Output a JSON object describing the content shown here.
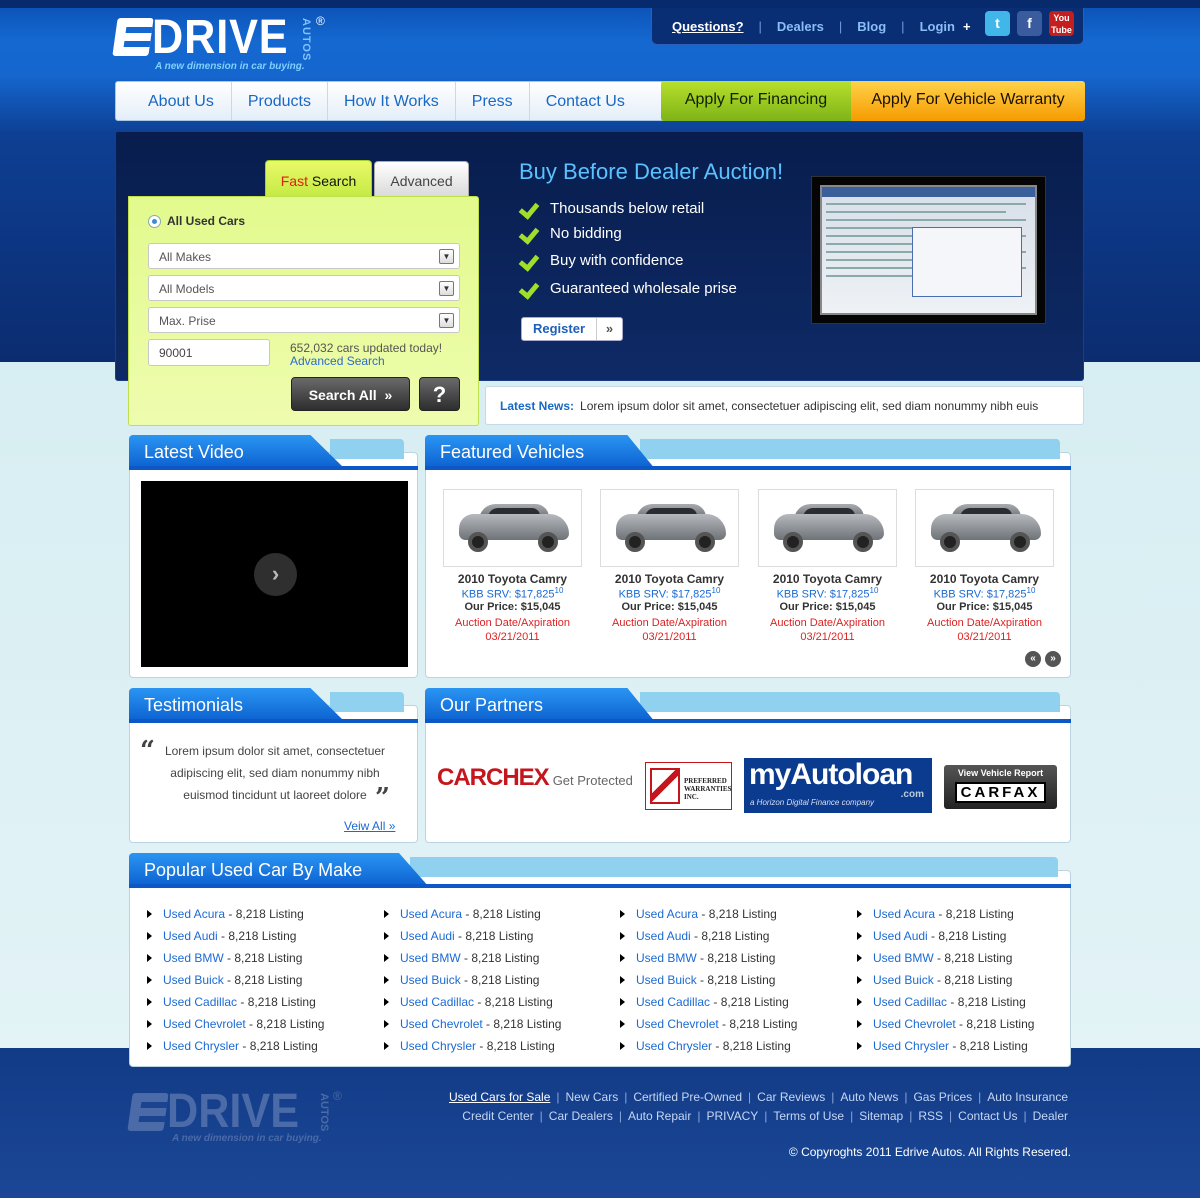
{
  "brand": {
    "name": "DRIVE",
    "sub": "AUTOS",
    "reg": "®",
    "tagline": "A new dimension in car buying."
  },
  "toplinks": [
    "Questions?",
    "Dealers",
    "Blog",
    "Login"
  ],
  "social": [
    "twitter-icon",
    "facebook-icon",
    "youtube-icon"
  ],
  "nav": [
    "About Us",
    "Products",
    "How It Works",
    "Press",
    "Contact Us"
  ],
  "nav_cta": {
    "financing": "Apply For Financing",
    "warranty": "Apply For Vehicle Warranty"
  },
  "search": {
    "tab_fast_a": "Fast",
    "tab_fast_b": " Search",
    "tab_advanced": "Advanced",
    "radio": "All Used Cars",
    "makes": "All Makes",
    "models": "All Models",
    "price": "Max. Prise",
    "zip": "90001",
    "count": "652,032 cars updated today!",
    "adv_link": "Advanced Search",
    "btn": "Search All",
    "btn_arrow": "»",
    "help": "?"
  },
  "hero": {
    "title": "Buy Before Dealer Auction!",
    "features": [
      "Thousands below retail",
      "No bidding",
      "Buy with confidence",
      "Guaranteed wholesale prise"
    ],
    "register": "Register",
    "register_arrow": "»"
  },
  "news": {
    "label": "Latest News:",
    "text": "Lorem ipsum dolor sit amet, consectetuer adipiscing elit, sed diam nonummy nibh euis"
  },
  "video": {
    "title": "Latest Video",
    "play": "›"
  },
  "featured": {
    "title": "Featured Vehicles",
    "cars": [
      {
        "name": "2010 Toyota Camry",
        "kbb": "KBB SRV: $17,825",
        "kbb_sup": "10",
        "price": "Our Price: $15,045",
        "auction": "Auction Date/Axpiration",
        "date": "03/21/2011"
      },
      {
        "name": "2010 Toyota Camry",
        "kbb": "KBB SRV: $17,825",
        "kbb_sup": "10",
        "price": "Our Price: $15,045",
        "auction": "Auction Date/Axpiration",
        "date": "03/21/2011"
      },
      {
        "name": "2010 Toyota Camry",
        "kbb": "KBB SRV: $17,825",
        "kbb_sup": "10",
        "price": "Our Price: $15,045",
        "auction": "Auction Date/Axpiration",
        "date": "03/21/2011"
      },
      {
        "name": "2010 Toyota Camry",
        "kbb": "KBB SRV: $17,825",
        "kbb_sup": "10",
        "price": "Our Price: $15,045",
        "auction": "Auction Date/Axpiration",
        "date": "03/21/2011"
      }
    ],
    "prev": "«",
    "next": "»"
  },
  "testimonials": {
    "title": "Testimonials",
    "open": "“",
    "close": "”",
    "text": "Lorem ipsum dolor sit amet, consectetuer adipiscing elit, sed diam nonummy nibh euismod tincidunt ut laoreet dolore",
    "view_all": "Veiw All »"
  },
  "partners": {
    "title": "Our Partners",
    "carchex": "CARCHEX",
    "carchex_sub": "Get Protected",
    "pw": "PREFERRED WARRANTIES INC.",
    "mal": "myAutoloan",
    "mal_com": ".com",
    "mal_sub": "a Horizon Digital Finance company",
    "carfax_top": "View Vehicle Report",
    "carfax": "CARFAX"
  },
  "popular": {
    "title": "Popular Used Car By Make",
    "makes": [
      "Used Acura",
      "Used Audi",
      "Used BMW",
      "Used Buick",
      "Used Cadillac",
      "Used Chevrolet",
      "Used Chrysler"
    ],
    "listing": " - 8,218 Listing"
  },
  "footer": {
    "row1": [
      "Used Cars for Sale",
      "New Cars",
      "Certified Pre-Owned",
      "Car Reviews",
      "Auto News",
      "Gas Prices",
      "Auto Insurance"
    ],
    "row2": [
      "Credit Center",
      "Car Dealers",
      "Auto Repair",
      "PRIVACY",
      "Terms of Use",
      "Sitemap",
      "RSS",
      "Contact Us",
      "Dealer"
    ],
    "copyright": "© Copyroghts 2011 Edrive Autos. All Rights Resered."
  }
}
